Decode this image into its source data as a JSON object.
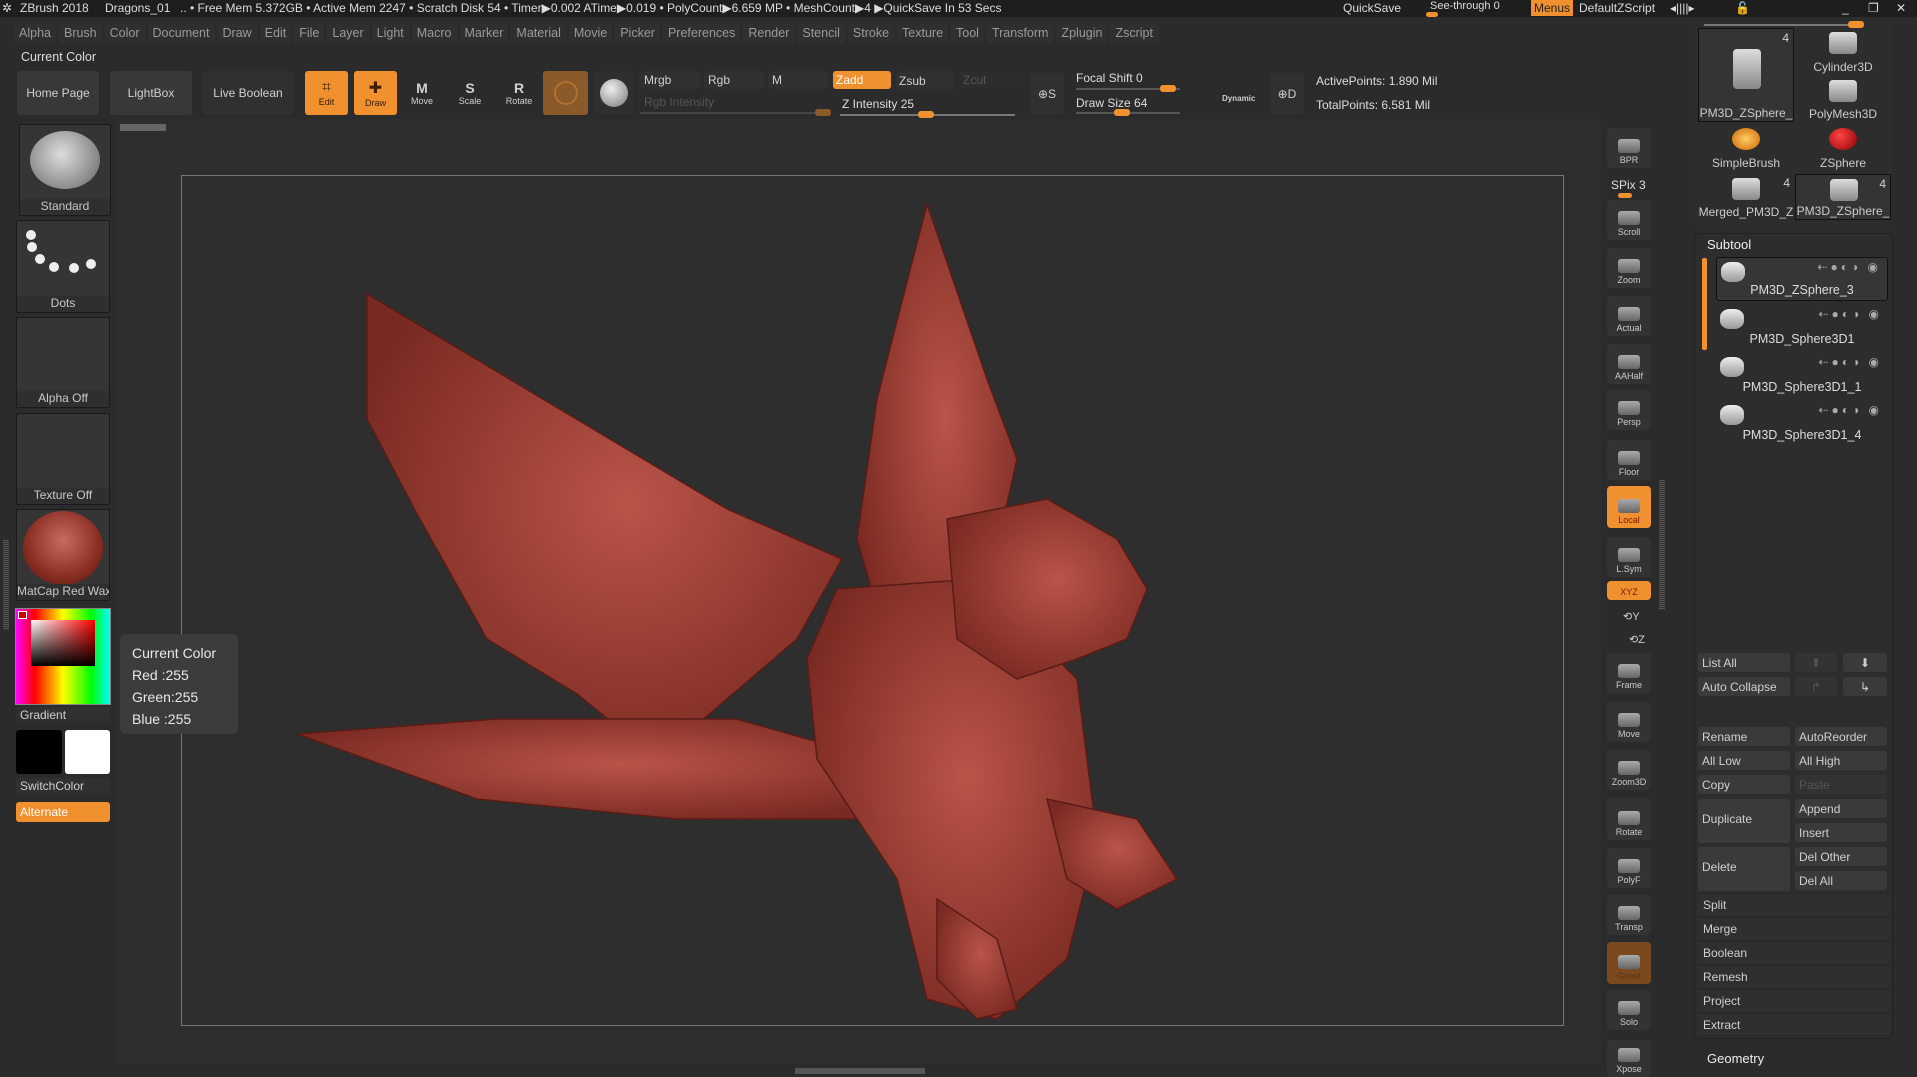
{
  "titlebar": {
    "app": "ZBrush 2018",
    "doc": "Dragons_01",
    "stats": ".. • Free Mem 5.372GB • Active Mem 2247 • Scratch Disk 54 •  Timer▶0.002 ATime▶0.019 • PolyCount▶6.659 MP  • MeshCount▶4  ▶QuickSave In 53 Secs",
    "quicksave": "QuickSave",
    "see_through": "See-through  0",
    "see_through_value": 0,
    "menus": "Menus",
    "script": "DefaultZScript"
  },
  "menus": [
    "Alpha",
    "Brush",
    "Color",
    "Document",
    "Draw",
    "Edit",
    "File",
    "Layer",
    "Light",
    "Macro",
    "Marker",
    "Material",
    "Movie",
    "Picker",
    "Preferences",
    "Render",
    "Stencil",
    "Stroke",
    "Texture",
    "Tool",
    "Transform",
    "Zplugin",
    "Zscript"
  ],
  "palette_label": "Current Color",
  "toolbar": {
    "home": "Home Page",
    "lightbox": "LightBox",
    "live_boolean": "Live Boolean",
    "edit": "Edit",
    "draw": "Draw",
    "move": "Move",
    "scale": "Scale",
    "rotate": "Rotate",
    "mrgb": "Mrgb",
    "rgb": "Rgb",
    "m": "M",
    "zadd": "Zadd",
    "zsub": "Zsub",
    "zcut": "Zcut",
    "rgb_intensity": "Rgb Intensity",
    "z_intensity": "Z Intensity 25",
    "focal_shift": "Focal Shift 0",
    "draw_size": "Draw Size 64",
    "dynamic": "Dynamic",
    "active_points": "ActivePoints: 1.890 Mil",
    "total_points": "TotalPoints: 6.581 Mil",
    "z_intensity_value": 25,
    "focal_shift_value": 0,
    "draw_size_value": 64
  },
  "left": {
    "brush": "Standard",
    "stroke": "Dots",
    "alpha": "Alpha Off",
    "texture": "Texture Off",
    "material": "MatCap Red Wax",
    "gradient": "Gradient",
    "switch": "SwitchColor",
    "alternate": "Alternate"
  },
  "tooltip": {
    "title": "Current Color",
    "red": "Red  :255",
    "green": "Green:255",
    "blue": "Blue :255"
  },
  "shelf": [
    "BPR",
    "SPix 3",
    "Scroll",
    "Zoom",
    "Actual",
    "AAHalf",
    "Persp",
    "Floor",
    "Local",
    "L.Sym",
    "XYZ",
    "Frame",
    "Move",
    "Zoom3D",
    "Rotate",
    "PolyF",
    "Transp",
    "Ghost",
    "Solo",
    "Xpose"
  ],
  "tools": [
    {
      "name": "PM3D_ZSphere_",
      "count": "4"
    },
    {
      "name": "Cylinder3D"
    },
    {
      "name": "PolyMesh3D"
    },
    {
      "name": "SimpleBrush"
    },
    {
      "name": "ZSphere"
    },
    {
      "name": "Merged_PM3D_Z",
      "count": "4"
    },
    {
      "name": "PM3D_ZSphere_",
      "count": "4"
    }
  ],
  "subtool": {
    "title": "Subtool",
    "items": [
      "PM3D_ZSphere_3",
      "PM3D_Sphere3D1",
      "PM3D_Sphere3D1_1",
      "PM3D_Sphere3D1_4"
    ],
    "list_all": "List All",
    "auto_collapse": "Auto Collapse",
    "rename": "Rename",
    "autoreorder": "AutoReorder",
    "all_low": "All Low",
    "all_high": "All High",
    "copy": "Copy",
    "paste": "Paste",
    "duplicate": "Duplicate",
    "append": "Append",
    "insert": "Insert",
    "delete": "Delete",
    "del_other": "Del Other",
    "del_all": "Del All",
    "rows": [
      "Split",
      "Merge",
      "Boolean",
      "Remesh",
      "Project",
      "Extract"
    ]
  },
  "geometry": "Geometry",
  "colors": {
    "accent": "#f0902e",
    "model": "#a8463c"
  }
}
